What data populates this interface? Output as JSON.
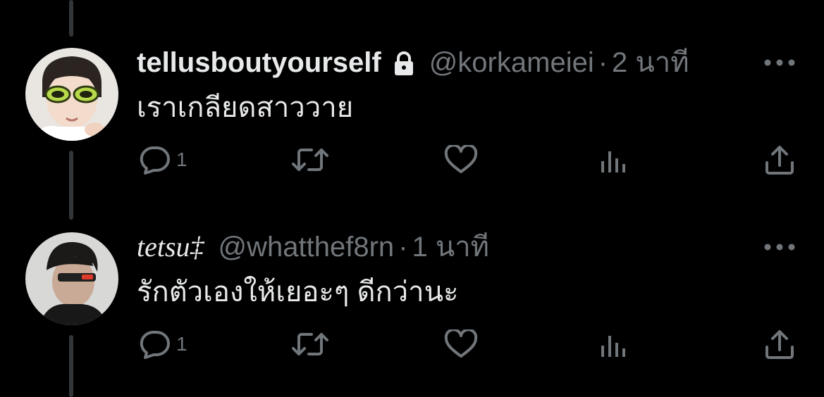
{
  "colors": {
    "background": "#000000",
    "primary_text": "#e7e9ea",
    "secondary_text": "#71767b",
    "thread_line": "#333639"
  },
  "tweets": [
    {
      "display_name": "tellusboutyourself",
      "protected_icon": "lock-icon",
      "handle": "@korkameiei",
      "separator": "·",
      "time": "2 นาที",
      "text": "เราเกลียดสาววาย",
      "reply_count": "1",
      "more_icon": "more-icon"
    },
    {
      "display_name": "tetsu‡",
      "handle": "@whatthef8rn",
      "separator": "·",
      "time": "1 นาที",
      "text": "รักตัวเองให้เยอะๆ ดีกว่านะ",
      "reply_count": "1",
      "more_icon": "more-icon"
    }
  ],
  "action_icons": [
    "reply-icon",
    "retweet-icon",
    "like-icon",
    "views-icon",
    "share-icon"
  ]
}
